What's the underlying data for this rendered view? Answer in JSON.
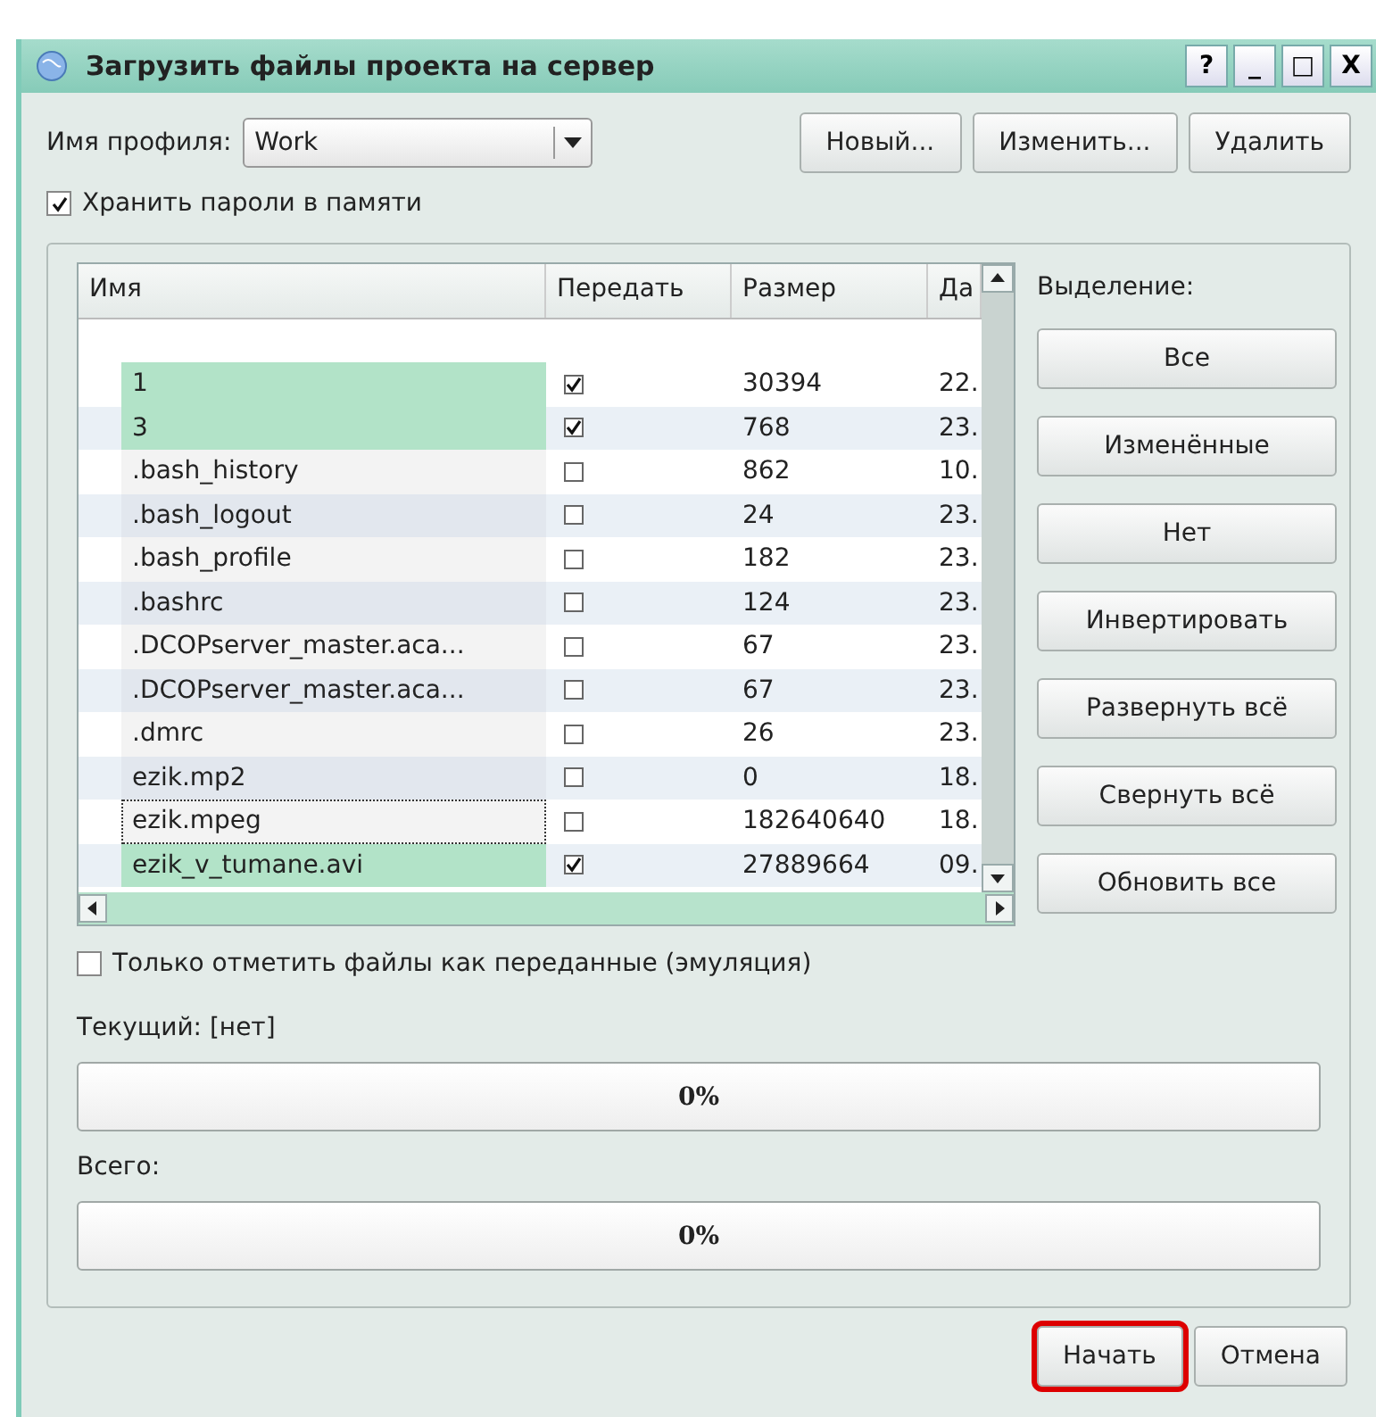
{
  "window": {
    "title": "Загрузить файлы проекта на сервер",
    "controls": [
      "?",
      "_",
      "□",
      "X"
    ]
  },
  "profile": {
    "label": "Имя профиля:",
    "value": "Work",
    "buttons": [
      "Новый...",
      "Изменить...",
      "Удалить"
    ]
  },
  "remember_passwords": {
    "label": "Хранить пароли в памяти",
    "checked": true
  },
  "table": {
    "columns": [
      "Имя",
      "Передать",
      "Размер",
      "Да"
    ],
    "rows": [
      {
        "name": "1",
        "transfer": true,
        "size": "30394",
        "date": "22.",
        "focused": false
      },
      {
        "name": "3",
        "transfer": true,
        "size": "768",
        "date": "23.",
        "focused": false
      },
      {
        "name": ".bash_history",
        "transfer": false,
        "size": "862",
        "date": "10.",
        "focused": false
      },
      {
        "name": ".bash_logout",
        "transfer": false,
        "size": "24",
        "date": "23.",
        "focused": false
      },
      {
        "name": ".bash_profile",
        "transfer": false,
        "size": "182",
        "date": "23.",
        "focused": false
      },
      {
        "name": ".bashrc",
        "transfer": false,
        "size": "124",
        "date": "23.",
        "focused": false
      },
      {
        "name": ".DCOPserver_master.aca...",
        "transfer": false,
        "size": "67",
        "date": "23.",
        "focused": false
      },
      {
        "name": ".DCOPserver_master.aca...",
        "transfer": false,
        "size": "67",
        "date": "23.",
        "focused": false
      },
      {
        "name": ".dmrc",
        "transfer": false,
        "size": "26",
        "date": "23.",
        "focused": false
      },
      {
        "name": "ezik.mp2",
        "transfer": false,
        "size": "0",
        "date": "18.",
        "focused": false
      },
      {
        "name": "ezik.mpeg",
        "transfer": false,
        "size": "182640640",
        "date": "18.",
        "focused": true
      },
      {
        "name": "ezik_v_tumane.avi",
        "transfer": true,
        "size": "27889664",
        "date": "09.",
        "focused": false
      }
    ]
  },
  "selection": {
    "label": "Выделение:",
    "buttons": [
      "Все",
      "Изменённые",
      "Нет",
      "Инвертировать",
      "Развернуть всё",
      "Свернуть всё",
      "Обновить все"
    ]
  },
  "emulation": {
    "label": "Только отметить файлы как переданные (эмуляция)",
    "checked": false
  },
  "current": {
    "label": "Текущий: [нет]",
    "level": 0,
    "text": "0%"
  },
  "total": {
    "label": "Всего:",
    "level": 0,
    "text": "0%"
  },
  "footer": [
    {
      "label": "Начать",
      "highlighted": true
    },
    {
      "label": "Отмена",
      "highlighted": false
    }
  ]
}
